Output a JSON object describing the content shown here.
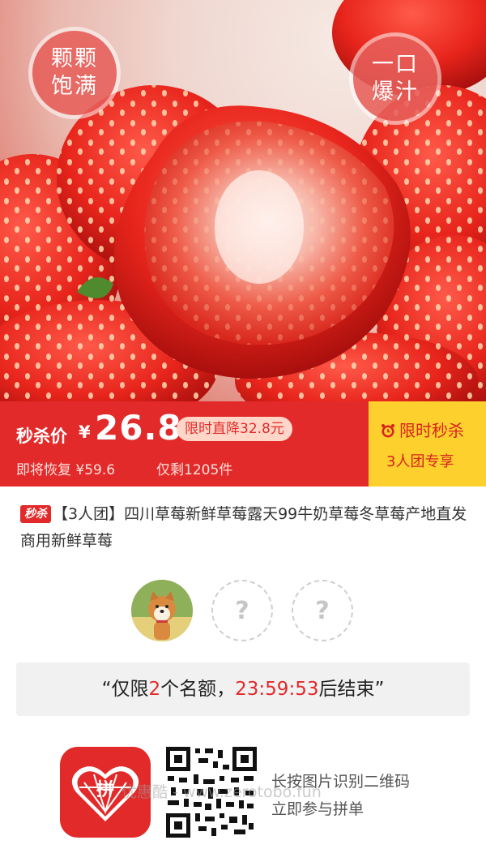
{
  "hero": {
    "badge_left": [
      "颗颗",
      "饱满"
    ],
    "badge_right": [
      "一口",
      "爆汁"
    ]
  },
  "price": {
    "label": "秒杀价",
    "currency": "¥",
    "value": "26.8",
    "drop_tag": "限时直降32.8元",
    "restore": "即将恢复 ¥59.6",
    "remain": "仅剩1205件",
    "side_title": "限时秒杀",
    "side_sub": "3人团专享"
  },
  "product": {
    "flash_tag": "秒杀",
    "title": "【3人团】四川草莓新鲜草莓露天99牛奶草莓冬草莓产地直发商用新鲜草莓"
  },
  "group": {
    "empty_slot": "?",
    "quota_open": "“仅限",
    "quota_count": "2",
    "quota_mid": "个名额，",
    "countdown": "23:59:53",
    "quota_end": "后结束”"
  },
  "footer": {
    "logo_text": "拼",
    "hint_line1": "长按图片识别二维码",
    "hint_line2": "立即参与拼单",
    "watermark": "优惠酷 - www.zerotobo.fun"
  },
  "colors": {
    "accent_red": "#e22a2a",
    "accent_yellow": "#fdd02e",
    "quota_bg": "#f1f1f1"
  },
  "icons": [
    "clock-icon",
    "qr-code-icon",
    "pinduoduo-logo-icon"
  ]
}
